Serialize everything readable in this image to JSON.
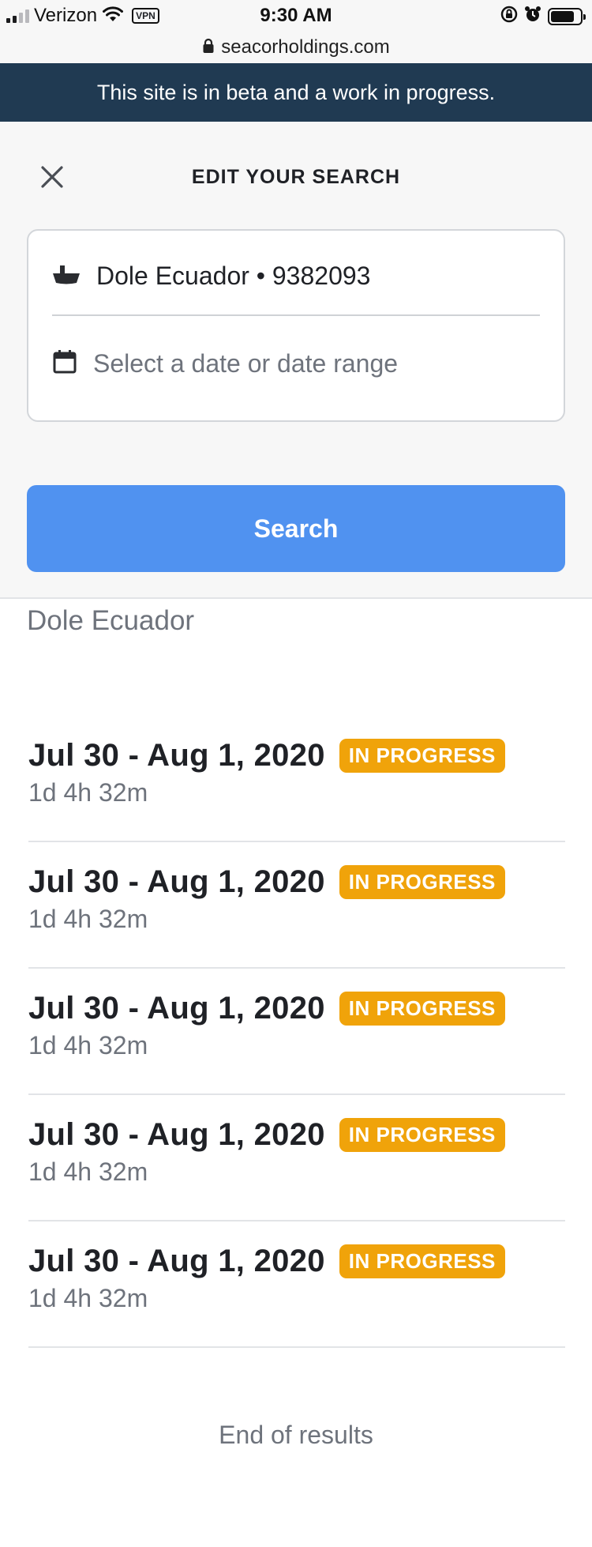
{
  "status_bar": {
    "carrier": "Verizon",
    "vpn": "VPN",
    "time": "9:30 AM"
  },
  "url_bar": {
    "domain": "seacorholdings.com"
  },
  "banner": {
    "text": "This site is in beta and a work in progress."
  },
  "search_panel": {
    "title": "EDIT YOUR SEARCH",
    "vessel_value": "Dole Ecuador • 9382093",
    "date_placeholder": "Select a date or date range",
    "search_label": "Search"
  },
  "results": {
    "heading": "Dole Ecuador",
    "items": [
      {
        "dates": "Jul 30 - Aug 1, 2020",
        "status": "IN PROGRESS",
        "duration": "1d 4h 32m"
      },
      {
        "dates": "Jul 30 - Aug 1, 2020",
        "status": "IN PROGRESS",
        "duration": "1d 4h 32m"
      },
      {
        "dates": "Jul 30 - Aug 1, 2020",
        "status": "IN PROGRESS",
        "duration": "1d 4h 32m"
      },
      {
        "dates": "Jul 30 - Aug 1, 2020",
        "status": "IN PROGRESS",
        "duration": "1d 4h 32m"
      },
      {
        "dates": "Jul 30 - Aug 1, 2020",
        "status": "IN PROGRESS",
        "duration": "1d 4h 32m"
      }
    ],
    "end_text": "End of results"
  },
  "icons": {
    "close": "close-icon",
    "ship": "ship-icon",
    "calendar": "calendar-icon",
    "lock": "lock-icon"
  },
  "colors": {
    "banner_bg": "#203a52",
    "primary": "#5092f0",
    "badge": "#f0a30a",
    "muted_text": "#6e737c"
  }
}
